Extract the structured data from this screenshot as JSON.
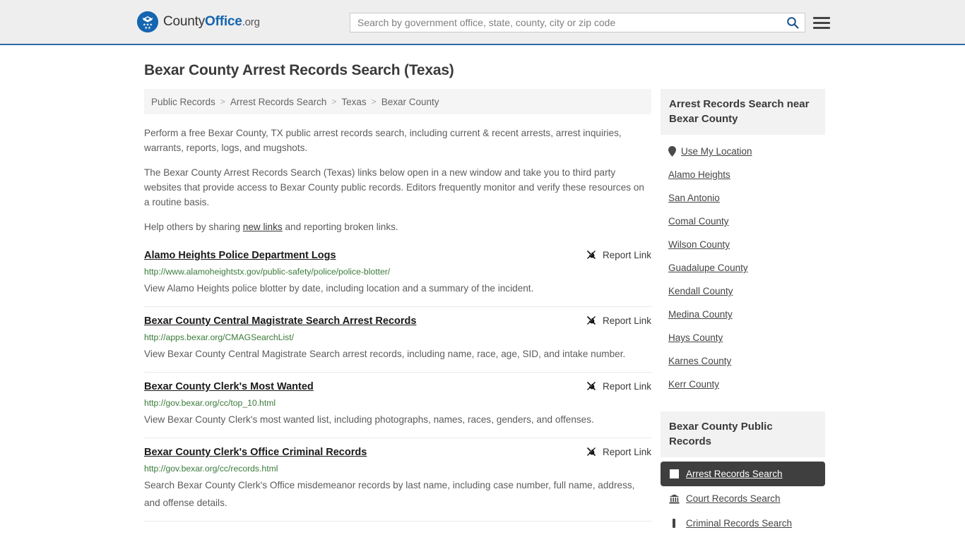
{
  "header": {
    "brand": {
      "part1": "County",
      "part2": "Office",
      "part3": ".org",
      "logo_icon": "eagle-shield-icon"
    },
    "search": {
      "placeholder": "Search by government office, state, county, city or zip code",
      "value": "",
      "search_icon": "search-icon"
    },
    "menu_icon": "hamburger-menu-icon",
    "accent_color": "#2d6ca2",
    "background_color": "#eeeeee"
  },
  "page": {
    "title": "Bexar County Arrest Records Search (Texas)"
  },
  "breadcrumb": {
    "separator": ">",
    "items": [
      {
        "label": "Public Records"
      },
      {
        "label": "Arrest Records Search"
      },
      {
        "label": "Texas"
      },
      {
        "label": "Bexar County"
      }
    ]
  },
  "intro": {
    "p1": "Perform a free Bexar County, TX public arrest records search, including current & recent arrests, arrest inquiries, warrants, reports, logs, and mugshots.",
    "p2": "The Bexar County Arrest Records Search (Texas) links below open in a new window and take you to third party websites that provide access to Bexar County public records. Editors frequently monitor and verify these resources on a routine basis.",
    "p3_before": "Help others by sharing ",
    "p3_link": "new links",
    "p3_after": " and reporting broken links."
  },
  "results": {
    "report_link_label": "Report Link",
    "report_link_icon": "broken-link-icon",
    "items": [
      {
        "title": "Alamo Heights Police Department Logs",
        "url": "http://www.alamoheightstx.gov/public-safety/police/police-blotter/",
        "description": "View Alamo Heights police blotter by date, including location and a summary of the incident."
      },
      {
        "title": "Bexar County Central Magistrate Search Arrest Records",
        "url": "http://apps.bexar.org/CMAGSearchList/",
        "description": "View Bexar County Central Magistrate Search arrest records, including name, race, age, SID, and intake number."
      },
      {
        "title": "Bexar County Clerk's Most Wanted",
        "url": "http://gov.bexar.org/cc/top_10.html",
        "description": "View Bexar County Clerk's most wanted list, including photographs, names, races, genders, and offenses."
      },
      {
        "title": "Bexar County Clerk's Office Criminal Records",
        "url": "http://gov.bexar.org/cc/records.html",
        "description": "Search Bexar County Clerk's Office misdemeanor records by last name, including case number, full name, address, and offense details."
      }
    ]
  },
  "sidebar": {
    "near": {
      "heading": "Arrest Records Search near Bexar County",
      "use_my_location": {
        "label": "Use My Location",
        "icon": "map-pin-icon"
      },
      "items": [
        {
          "label": "Alamo Heights"
        },
        {
          "label": "San Antonio"
        },
        {
          "label": "Comal County"
        },
        {
          "label": "Wilson County"
        },
        {
          "label": "Guadalupe County"
        },
        {
          "label": "Kendall County"
        },
        {
          "label": "Medina County"
        },
        {
          "label": "Hays County"
        },
        {
          "label": "Karnes County"
        },
        {
          "label": "Kerr County"
        }
      ]
    },
    "records": {
      "heading": "Bexar County Public Records",
      "active_background": "#3f3f3f",
      "items": [
        {
          "label": "Arrest Records Search",
          "icon": "document-icon",
          "active": true
        },
        {
          "label": "Court Records Search",
          "icon": "courthouse-icon",
          "active": false
        },
        {
          "label": "Criminal Records Search",
          "icon": "gavel-icon",
          "active": false
        }
      ]
    }
  }
}
